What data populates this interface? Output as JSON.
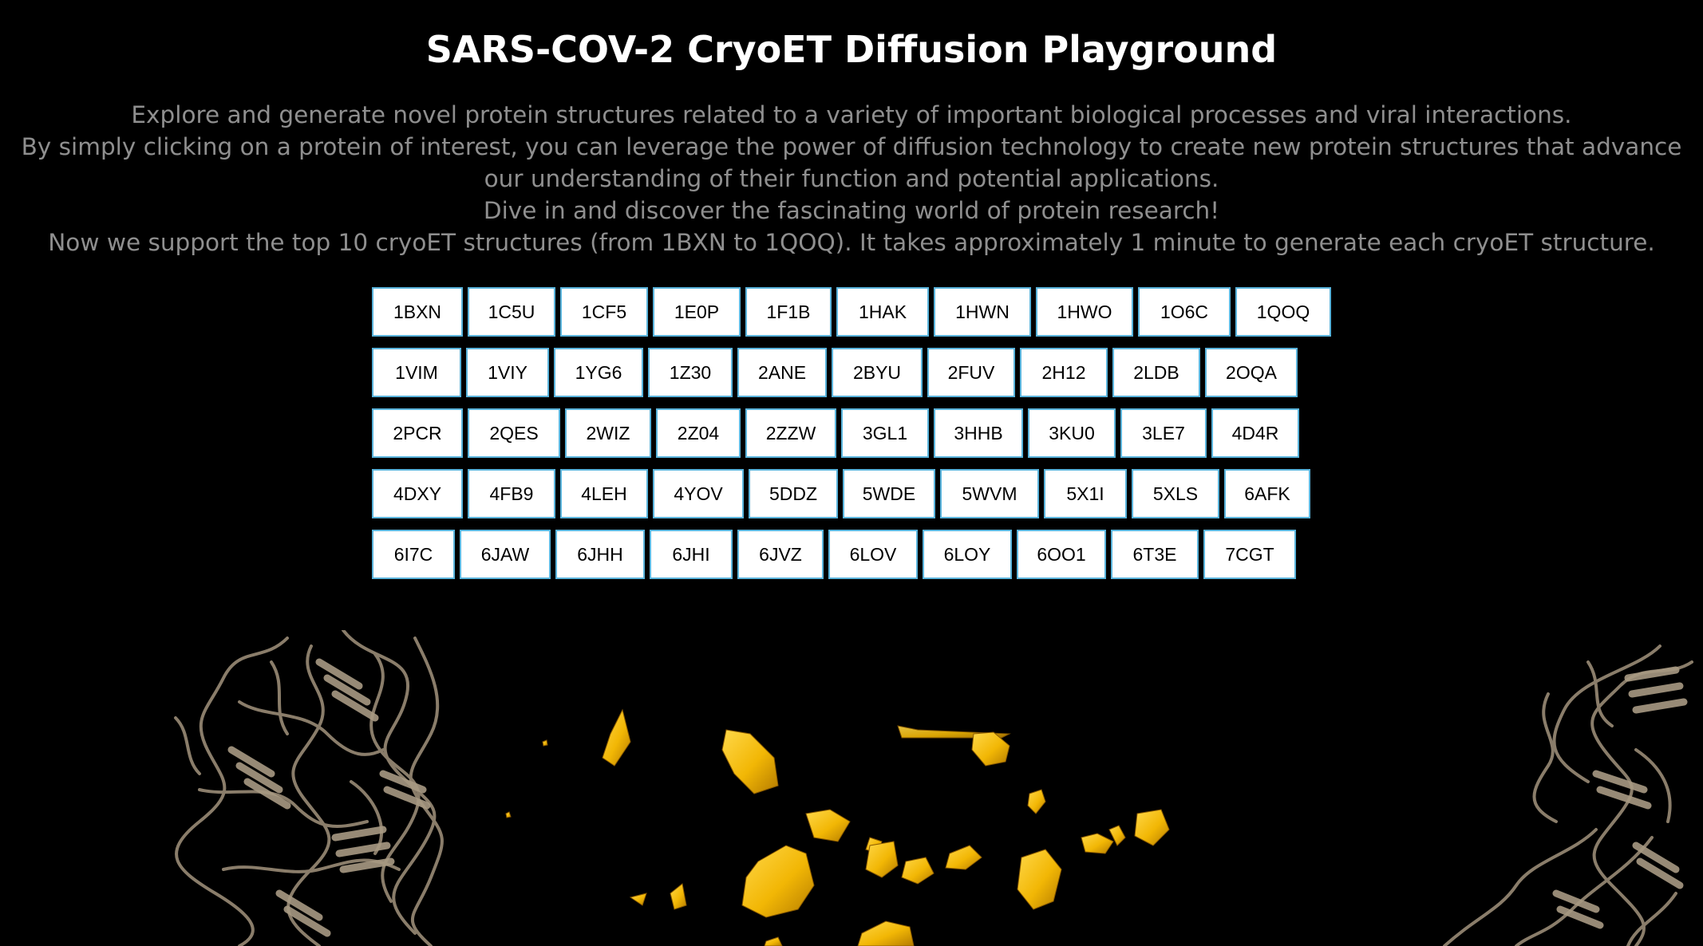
{
  "header": {
    "title": "SARS-COV-2 CryoET Diffusion Playground"
  },
  "intro": {
    "line1": "Explore and generate novel protein structures related to a variety of important biological processes and viral interactions.",
    "line2": "By simply clicking on a protein of interest, you can leverage the power of diffusion technology to create new protein structures that advance our understanding of their function and potential applications.",
    "line3": "Dive in and discover the fascinating world of protein research!",
    "line4": "Now we support the top 10 cryoET structures (from 1BXN to 1QOQ). It takes approximately 1 minute to generate each cryoET structure."
  },
  "proteins": {
    "rows": [
      [
        "1BXN",
        "1C5U",
        "1CF5",
        "1E0P",
        "1F1B",
        "1HAK",
        "1HWN",
        "1HWO",
        "1O6C",
        "1QOQ"
      ],
      [
        "1VIM",
        "1VIY",
        "1YG6",
        "1Z30",
        "2ANE",
        "2BYU",
        "2FUV",
        "2H12",
        "2LDB",
        "2OQA"
      ],
      [
        "2PCR",
        "2QES",
        "2WIZ",
        "2Z04",
        "2ZZW",
        "3GL1",
        "3HHB",
        "3KU0",
        "3LE7",
        "4D4R"
      ],
      [
        "4DXY",
        "4FB9",
        "4LEH",
        "4YOV",
        "5DDZ",
        "5WDE",
        "5WVM",
        "5X1I",
        "5XLS",
        "6AFK"
      ],
      [
        "6I7C",
        "6JAW",
        "6JHH",
        "6JHI",
        "6JVZ",
        "6LOV",
        "6LOY",
        "6OO1",
        "6T3E",
        "7CGT"
      ]
    ]
  },
  "colors": {
    "background": "#000000",
    "title": "#ffffff",
    "intro_text": "#8f8f8f",
    "button_border": "#5ab4dc",
    "button_bg": "#ffffff",
    "ribbon": "#8a7d6a",
    "density": "#f2b705"
  },
  "images": {
    "left_ribbon": "protein-ribbon-structure",
    "center_density": "cryoet-density-render",
    "right_ribbon": "protein-ribbon-structure"
  }
}
